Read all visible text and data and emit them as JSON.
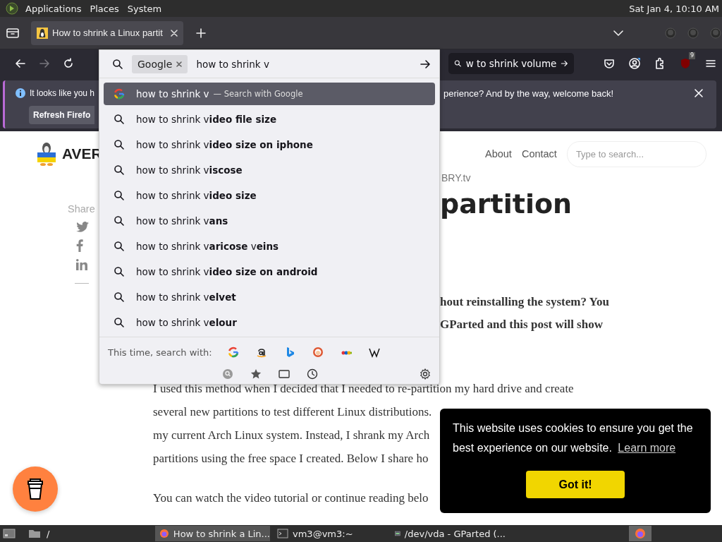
{
  "top_panel": {
    "menus": [
      "Applications",
      "Places",
      "System"
    ],
    "clock": "Sat Jan  4, 10:10 AM"
  },
  "tabs": [
    {
      "title": "How to shrink a Linux partit",
      "selected": true
    }
  ],
  "nav_buttons": [
    {
      "kind": "back",
      "disabled": false
    },
    {
      "kind": "forward",
      "disabled": true
    },
    {
      "kind": "reload",
      "disabled": false
    }
  ],
  "search_bar": {
    "value": "w to shrink volume"
  },
  "toolbar_icons": [
    {
      "kind": "pocket"
    },
    {
      "kind": "account"
    },
    {
      "kind": "extensions"
    },
    {
      "kind": "shield",
      "badge": "9"
    },
    {
      "kind": "menu"
    }
  ],
  "notification": {
    "text_start": "It looks like you h",
    "text_end": "perience? And by the way, welcome back!",
    "button": "Refresh Firefo"
  },
  "site": {
    "logo_text": "AVER",
    "tagline": "BRY.tv",
    "nav": [
      "About",
      "Contact"
    ],
    "search_placeholder": "Type to search...",
    "share_label": "Share",
    "share_icons": [
      {
        "kind": "twitter"
      },
      {
        "kind": "facebook"
      },
      {
        "kind": "linkedin"
      }
    ],
    "title": "partition",
    "intro": [
      "hout reinstalling the system? You",
      "GParted and this post will show"
    ],
    "body": [
      "I used this method when I decided that I needed to re-partition my hard drive and create",
      "several new partitions to test different Linux distributions.",
      "my current Arch Linux system. Instead, I shrank my Arch",
      "partitions using the free space I created. Below I share ho"
    ],
    "last": "You can watch the video tutorial or continue reading belo"
  },
  "url_dropdown": {
    "engine_chip": "Google",
    "query": "how to shrink v",
    "rows": [
      {
        "kind": "engine",
        "text": "how to shrink v",
        "hint": "— Search with Google",
        "selected": true
      },
      {
        "kind": "suggestion",
        "text": "how to shrink v**ideo file size**",
        "selected": false
      },
      {
        "kind": "suggestion",
        "text": "how to shrink v**ideo size on iphone**",
        "selected": false
      },
      {
        "kind": "suggestion",
        "text": "how to shrink v**iscose**",
        "selected": false
      },
      {
        "kind": "suggestion",
        "text": "how to shrink v**ideo size**",
        "selected": false
      },
      {
        "kind": "suggestion",
        "text": "how to shrink v**ans**",
        "selected": false
      },
      {
        "kind": "suggestion",
        "text": "how to shrink v**aricose** v**eins**",
        "selected": false
      },
      {
        "kind": "suggestion",
        "text": "how to shrink v**ideo size on android**",
        "selected": false
      },
      {
        "kind": "suggestion",
        "text": "how to shrink v**elvet**",
        "selected": false
      },
      {
        "kind": "suggestion",
        "text": "how to shrink v**elour**",
        "selected": false
      }
    ],
    "one_off_label": "This time, search with:",
    "engines": [
      {
        "kind": "google"
      },
      {
        "kind": "amazon"
      },
      {
        "kind": "bing"
      },
      {
        "kind": "duckduckgo"
      },
      {
        "kind": "ebay"
      },
      {
        "kind": "wikipedia"
      }
    ],
    "modes": [
      {
        "kind": "search"
      },
      {
        "kind": "bookmarks"
      },
      {
        "kind": "tabs"
      },
      {
        "kind": "history"
      }
    ]
  },
  "cookie": {
    "text": "This website uses cookies to ensure you get the best experience on our website.",
    "link": "Learn more",
    "button": "Got it!"
  },
  "taskbar": {
    "places": "/",
    "windows": [
      {
        "title": "How to shrink a Lin...",
        "selected": true
      },
      {
        "title": "vm3@vm3:~",
        "selected": false
      },
      {
        "title": "/dev/vda - GParted (...",
        "selected": false
      }
    ]
  }
}
